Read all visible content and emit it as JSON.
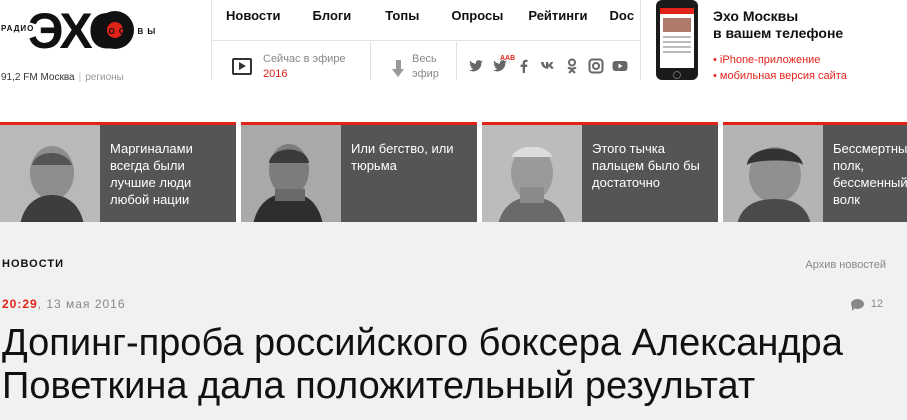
{
  "logo": {
    "radio": "РАДИО",
    "echo": "ЭХО",
    "moskvy": "МОСКВЫ"
  },
  "station": {
    "frequency": "91,2 FM Москва",
    "regions": "регионы"
  },
  "nav": [
    "Новости",
    "Блоги",
    "Топы",
    "Опросы",
    "Рейтинги",
    "Doc"
  ],
  "onair": {
    "label": "Сейчас в эфире",
    "value": "2016"
  },
  "allair": {
    "line1": "Весь",
    "line2": "эфир"
  },
  "social": {
    "badge": "AAB",
    "icons": [
      "twitter-icon",
      "twitter-alt-icon",
      "facebook-icon",
      "vkontakte-icon",
      "odnoklassniki-icon",
      "instagram-icon",
      "youtube-icon"
    ]
  },
  "mobile": {
    "title_line1": "Эхо Москвы",
    "title_line2": "в вашем телефоне",
    "links": [
      "iPhone-приложение",
      "мобильная версия сайта"
    ]
  },
  "teasers": [
    {
      "text": "Маргиналами всегда были лучшие люди любой нации"
    },
    {
      "text": "Или бегство, или тюрьма"
    },
    {
      "text": "Этого тычка пальцем было бы достаточно"
    },
    {
      "text": "Бессмертный полк, бессменный волк"
    }
  ],
  "news": {
    "section": "НОВОСТИ",
    "archive": "Архив новостей",
    "time": "20:29",
    "date": "13 мая 2016",
    "comments": "12",
    "headline_line1": "Допинг-проба российского боксера Александра",
    "headline_line2": "Поветкина дала положительный результат"
  },
  "colors": {
    "accent": "#e1231a",
    "teaser_bg": "#555555",
    "news_bg": "#f1f1f1"
  }
}
